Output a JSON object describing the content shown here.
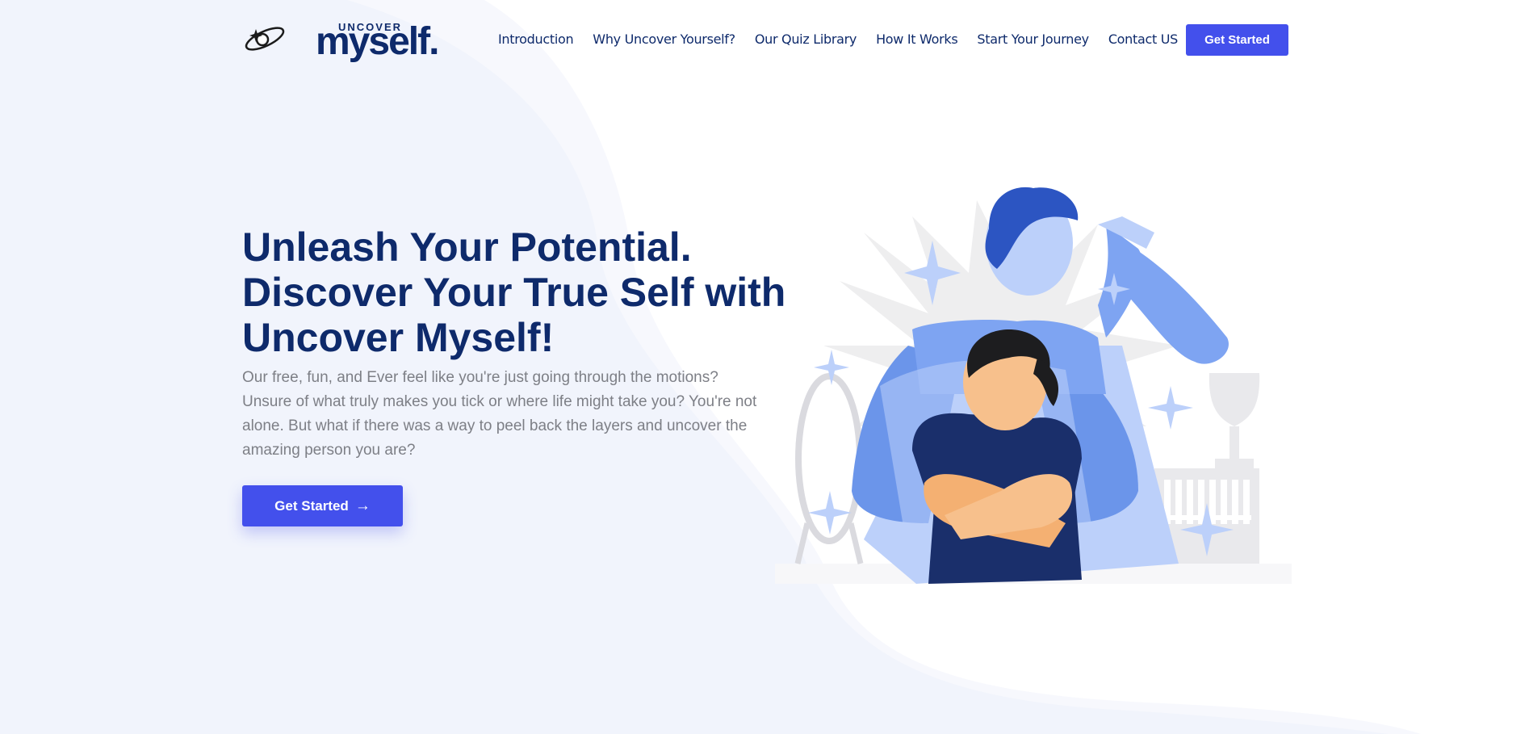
{
  "brand": {
    "small": "UNCOVER",
    "big": "myself."
  },
  "nav": {
    "items": [
      "Introduction",
      "Why Uncover Yourself?",
      "Our Quiz Library",
      "How It Works",
      "Start Your Journey",
      "Contact US"
    ],
    "cta": "Get Started"
  },
  "hero": {
    "title": "Unleash Your Potential. Discover Your True Self with Uncover Myself!",
    "description": "Our free, fun, and Ever feel like you're just going through the motions? Unsure of what truly makes you tick or where life might take you? You're not alone. But what if there was a way to peel back the layers and uncover the amazing person you are?",
    "cta": "Get Started",
    "cta_icon": "arrow-right-icon"
  },
  "colors": {
    "primary": "#4350ec",
    "navy": "#0e2a6b",
    "background": "#f1f4fc",
    "text_muted": "#7d7f86"
  }
}
